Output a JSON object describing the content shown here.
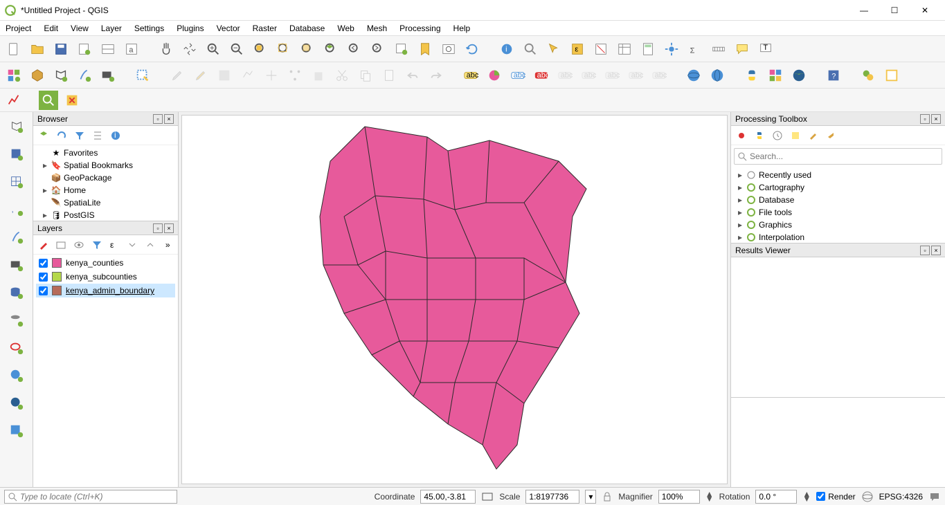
{
  "window": {
    "title": "*Untitled Project - QGIS"
  },
  "menu": [
    "Project",
    "Edit",
    "View",
    "Layer",
    "Settings",
    "Plugins",
    "Vector",
    "Raster",
    "Database",
    "Web",
    "Mesh",
    "Processing",
    "Help"
  ],
  "browser": {
    "title": "Browser",
    "items": [
      {
        "exp": "",
        "icon": "star",
        "label": "Favorites",
        "color": "#f5c518"
      },
      {
        "exp": "▸",
        "icon": "bookmark",
        "label": "Spatial Bookmarks",
        "color": "#888"
      },
      {
        "exp": "",
        "icon": "box",
        "label": "GeoPackage",
        "color": "#d9a441"
      },
      {
        "exp": "▸",
        "icon": "home",
        "label": "Home",
        "color": "#888"
      },
      {
        "exp": "",
        "icon": "feather",
        "label": "SpatiaLite",
        "color": "#5a8fd6"
      },
      {
        "exp": "▸",
        "icon": "db",
        "label": "PostGIS",
        "color": "#3a6fb0"
      }
    ]
  },
  "layers": {
    "title": "Layers",
    "items": [
      {
        "checked": true,
        "color": "#e75a9b",
        "label": "kenya_counties",
        "selected": false
      },
      {
        "checked": true,
        "color": "#b5d84a",
        "label": "kenya_subcounties",
        "selected": false
      },
      {
        "checked": true,
        "color": "#b66b5a",
        "label": "kenya_admin_boundary",
        "selected": true
      }
    ]
  },
  "processing": {
    "title": "Processing Toolbox",
    "search_placeholder": "Search...",
    "items": [
      {
        "icon": "clock",
        "label": "Recently used",
        "color": "#888"
      },
      {
        "icon": "q",
        "label": "Cartography",
        "color": "#7db342"
      },
      {
        "icon": "q",
        "label": "Database",
        "color": "#7db342"
      },
      {
        "icon": "q",
        "label": "File tools",
        "color": "#7db342"
      },
      {
        "icon": "q",
        "label": "Graphics",
        "color": "#7db342"
      },
      {
        "icon": "q",
        "label": "Interpolation",
        "color": "#7db342"
      }
    ]
  },
  "results": {
    "title": "Results Viewer"
  },
  "status": {
    "locator_placeholder": "Type to locate (Ctrl+K)",
    "coordinate_label": "Coordinate",
    "coordinate_value": "45.00,-3.81",
    "scale_label": "Scale",
    "scale_value": "1:8197736",
    "magnifier_label": "Magnifier",
    "magnifier_value": "100%",
    "rotation_label": "Rotation",
    "rotation_value": "0.0 °",
    "render_label": "Render",
    "crs_label": "EPSG:4326"
  },
  "map": {
    "fill": "#e75a9b",
    "stroke": "#2b2b2b"
  }
}
